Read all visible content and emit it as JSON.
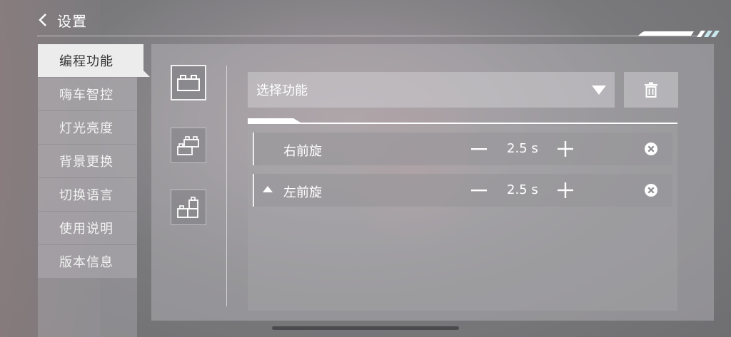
{
  "header": {
    "title": "设置",
    "back_icon": "chevron-left-icon"
  },
  "sidebar": {
    "items": [
      {
        "label": "编程功能",
        "active": true
      },
      {
        "label": "嗨车智控"
      },
      {
        "label": "灯光亮度"
      },
      {
        "label": "背景更换"
      },
      {
        "label": "切换语言"
      },
      {
        "label": "使用说明"
      },
      {
        "label": "版本信息"
      }
    ]
  },
  "block_buttons": [
    {
      "icon": "single-block-icon",
      "selected": true
    },
    {
      "icon": "stacked-blocks-icon",
      "selected": false
    },
    {
      "icon": "tower-blocks-icon",
      "selected": false
    }
  ],
  "function_select": {
    "value": "选择功能",
    "icon": "triangle-down-icon"
  },
  "delete_button": {
    "icon": "trash-icon"
  },
  "actions": [
    {
      "name": "右前旋",
      "value": "2.5 s"
    },
    {
      "name": "左前旋",
      "value": "2.5 s",
      "collapse_icon": "triangle-up-icon"
    }
  ],
  "colors": {
    "accent": "#ffffff",
    "active_tab_bg": "#ececec",
    "active_tab_text": "#333333"
  }
}
